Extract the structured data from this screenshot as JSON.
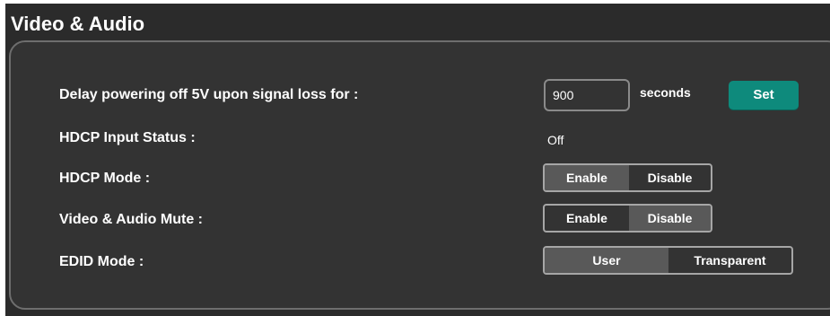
{
  "section": {
    "title": "Video & Audio"
  },
  "rows": {
    "delay": {
      "label": "Delay powering off 5V upon signal loss for :",
      "value": "900",
      "units": "seconds",
      "button": "Set",
      "button_color": "#0e8a7c"
    },
    "hdcp_status": {
      "label": "HDCP Input Status :",
      "value": "Off"
    },
    "hdcp_mode": {
      "label": "HDCP Mode :",
      "options": [
        "Enable",
        "Disable"
      ],
      "selected": "Enable"
    },
    "mute": {
      "label": "Video & Audio Mute :",
      "options": [
        "Enable",
        "Disable"
      ],
      "selected": "Disable"
    },
    "edid": {
      "label": "EDID Mode :",
      "options": [
        "User",
        "Transparent"
      ],
      "selected": "User"
    }
  }
}
